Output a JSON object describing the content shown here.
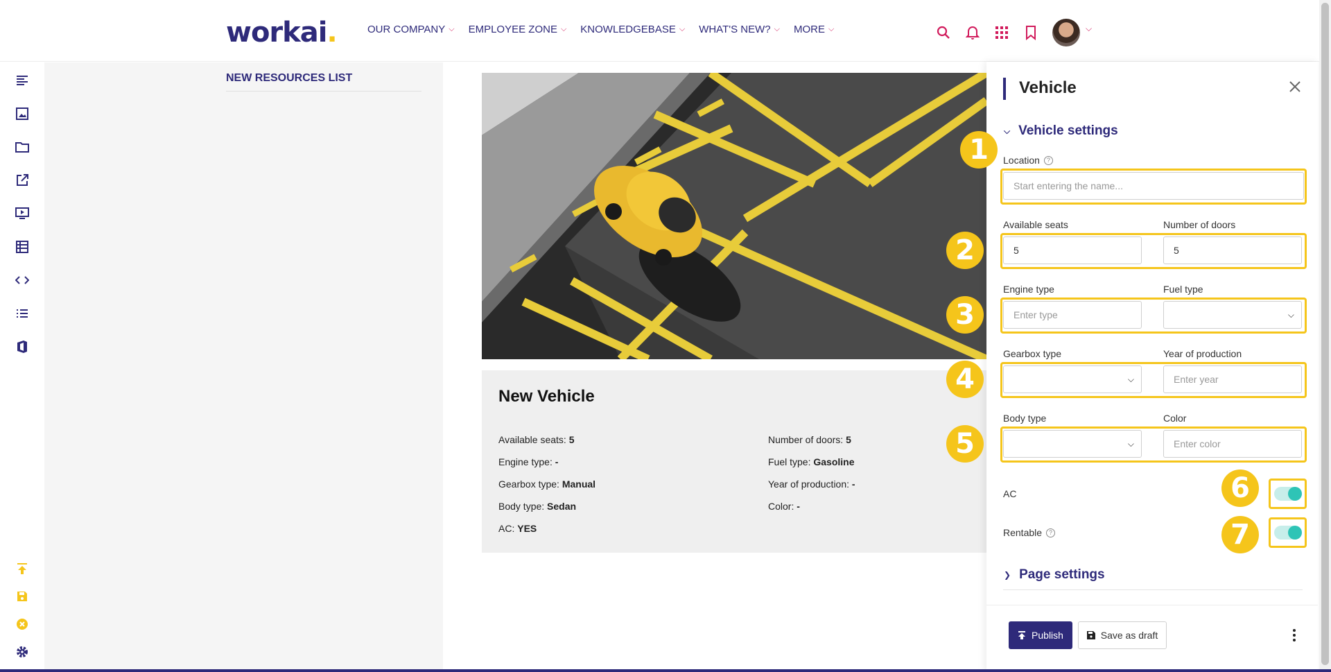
{
  "header": {
    "logo_text": "workai",
    "logo_dot": ".",
    "nav": [
      "OUR COMPANY",
      "EMPLOYEE ZONE",
      "KNOWLEDGEBASE",
      "WHAT'S NEW?",
      "MORE"
    ],
    "icons": [
      "search-icon",
      "bell-icon",
      "apps-grid-icon",
      "bookmark-icon"
    ]
  },
  "toolbar": {
    "top_icons": [
      "align-left-icon",
      "image-icon",
      "folder-icon",
      "external-link-icon",
      "video-icon",
      "table-icon",
      "code-icon",
      "list-icon",
      "office-icon"
    ],
    "bottom_icons": [
      "publish-up-icon",
      "save-icon",
      "cancel-icon",
      "gear-icon"
    ]
  },
  "left": {
    "title": "NEW RESOURCES LIST"
  },
  "card": {
    "title": "New Vehicle",
    "rows": [
      {
        "label": "Available seats:",
        "value": "5"
      },
      {
        "label": "Number of doors:",
        "value": "5"
      },
      {
        "label": "Engine type:",
        "value": "-"
      },
      {
        "label": "Fuel type:",
        "value": "Gasoline"
      },
      {
        "label": "Gearbox type:",
        "value": "Manual"
      },
      {
        "label": "Year of production:",
        "value": "-"
      },
      {
        "label": "Body type:",
        "value": "Sedan"
      },
      {
        "label": "Color:",
        "value": "-"
      },
      {
        "label": "AC:",
        "value": "YES"
      }
    ]
  },
  "panel": {
    "title": "Vehicle",
    "section": "Vehicle settings",
    "location_label": "Location",
    "location_placeholder": "Start entering the name...",
    "seats_label": "Available seats",
    "seats_value": "5",
    "doors_label": "Number of doors",
    "doors_value": "5",
    "engine_label": "Engine type",
    "engine_placeholder": "Enter type",
    "fuel_label": "Fuel type",
    "gearbox_label": "Gearbox type",
    "year_label": "Year of production",
    "year_placeholder": "Enter year",
    "body_label": "Body type",
    "color_label": "Color",
    "color_placeholder": "Enter color",
    "ac_label": "AC",
    "ac_on": true,
    "rentable_label": "Rentable",
    "rentable_on": true,
    "page_settings": "Page settings",
    "publish_label": "Publish",
    "draft_label": "Save as draft",
    "badges": [
      "1",
      "2",
      "3",
      "4",
      "5",
      "6",
      "7"
    ]
  },
  "colors": {
    "brand": "#2e2a7a",
    "accent": "#d11a5b",
    "highlight": "#f5c51b",
    "toggle": "#2ec4b6"
  }
}
